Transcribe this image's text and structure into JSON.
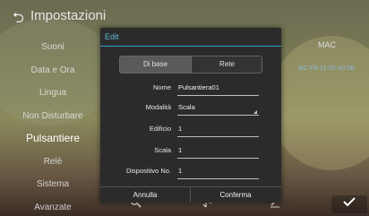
{
  "header": {
    "back_icon": "back-arrow-icon",
    "title": "Impostazioni"
  },
  "sidebar": {
    "items": [
      {
        "label": "Suoni"
      },
      {
        "label": "Data e Ora"
      },
      {
        "label": "Lingua"
      },
      {
        "label": "Non Disturbare"
      },
      {
        "label": "Pulsantiere",
        "active": true
      },
      {
        "label": "Relè"
      },
      {
        "label": "Sistema"
      },
      {
        "label": "Avanzate"
      }
    ]
  },
  "right_panel": {
    "label": "MAC",
    "value": "BC:F8:11:55:40:0E"
  },
  "bottom_bar": {
    "icons": [
      "search-icon",
      "sort-icon",
      "edit-icon",
      "check-icon"
    ]
  },
  "dialog": {
    "title": "Edit",
    "tabs": [
      {
        "label": "Di base",
        "selected": true
      },
      {
        "label": "Rete",
        "selected": false
      }
    ],
    "fields": {
      "name_label": "Nome",
      "name_value": "Pulsantiera01",
      "mode_label": "Modalità",
      "mode_value": "Scala",
      "building_label": "Edificio",
      "building_value": "1",
      "stair_label": "Scala",
      "stair_value": "1",
      "device_label": "Dispositivo No.",
      "device_value": "1"
    },
    "buttons": {
      "cancel": "Annulla",
      "confirm": "Conferma"
    }
  },
  "colors": {
    "accent": "#3aa0c8",
    "dialog_bg": "#2b2b2b",
    "mac_text": "#8fb6d6"
  }
}
